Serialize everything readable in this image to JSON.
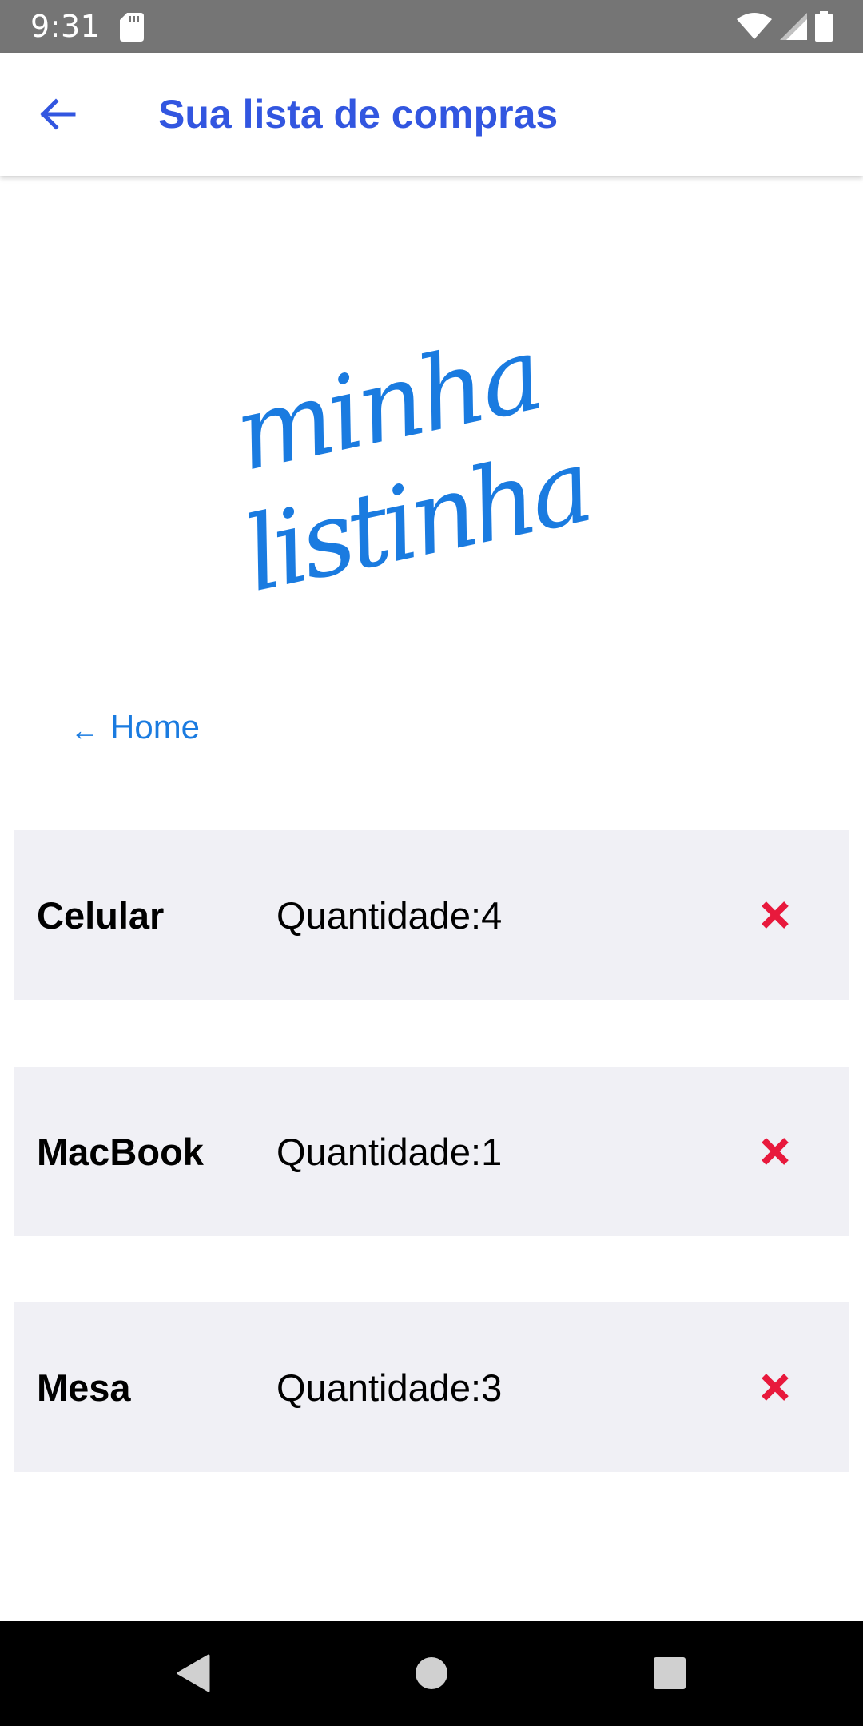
{
  "status_bar": {
    "time": "9:31",
    "icons": [
      "sd-card-icon",
      "wifi-icon",
      "signal-icon",
      "battery-icon"
    ]
  },
  "app_bar": {
    "title": "Sua lista de compras",
    "back_icon": "arrow-left-icon",
    "accent_color": "#3256e0"
  },
  "logo": {
    "text_line1": "minha",
    "text_line2": "listinha",
    "color": "#1a7be0"
  },
  "home_link": {
    "arrow": "←",
    "label": "Home",
    "color": "#1a7be0"
  },
  "items": [
    {
      "name": "Celular",
      "qty_label": "Quantidade: ",
      "qty": "4"
    },
    {
      "name": "MacBook",
      "qty_label": "Quantidade: ",
      "qty": "1"
    },
    {
      "name": "Mesa",
      "qty_label": "Quantidade: ",
      "qty": "3"
    }
  ],
  "remove_icon": {
    "name": "close-icon",
    "color": "#e8193c"
  },
  "nav_bar": {
    "buttons": [
      "back-triangle-icon",
      "home-circle-icon",
      "recents-square-icon"
    ]
  }
}
